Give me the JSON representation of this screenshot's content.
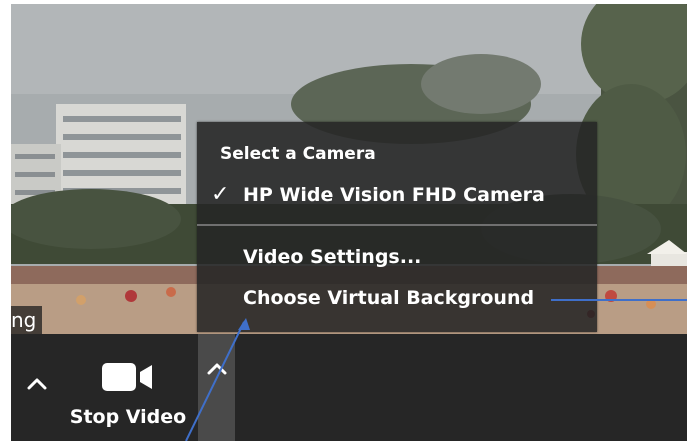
{
  "participant": {
    "name_fragment": "ng"
  },
  "toolbar": {
    "video_caret_icon": "chevron-up-icon",
    "stop_video_label": "Stop Video",
    "camera_icon": "video-camera-icon",
    "options_caret_icon": "chevron-up-icon"
  },
  "camera_menu": {
    "heading": "Select a Camera",
    "selected_mark": "✓",
    "camera_name": "HP Wide Vision FHD Camera",
    "video_settings": "Video Settings...",
    "virtual_background": "Choose Virtual Background"
  },
  "colors": {
    "toolbar_bg": "#262626",
    "menu_bg": "#262626",
    "annotation_line": "#3f6fc9"
  }
}
